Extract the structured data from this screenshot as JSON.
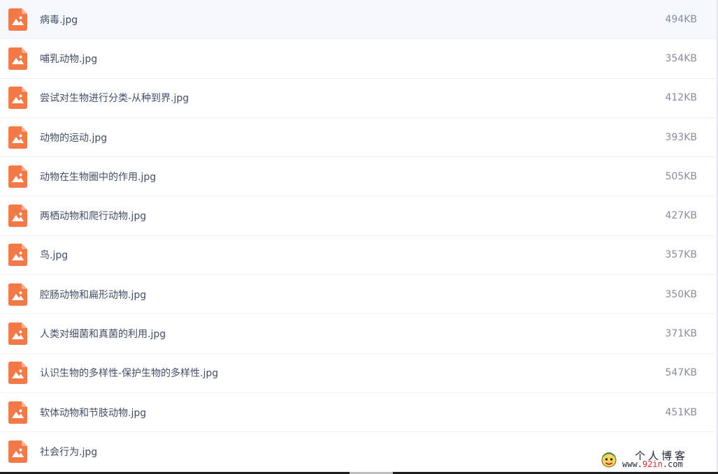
{
  "colors": {
    "icon_orange": "#f37a48",
    "name_text": "#424e67",
    "size_text": "#878c9c",
    "row_divider": "#eef0f4",
    "watermark_accent": "#d12a2a"
  },
  "files": [
    {
      "name": "病毒.jpg",
      "size": "494KB",
      "icon": "image-file-icon"
    },
    {
      "name": "哺乳动物.jpg",
      "size": "354KB",
      "icon": "image-file-icon"
    },
    {
      "name": "尝试对生物进行分类-从种到界.jpg",
      "size": "412KB",
      "icon": "image-file-icon"
    },
    {
      "name": "动物的运动.jpg",
      "size": "393KB",
      "icon": "image-file-icon"
    },
    {
      "name": "动物在生物圈中的作用.jpg",
      "size": "505KB",
      "icon": "image-file-icon"
    },
    {
      "name": "两栖动物和爬行动物.jpg",
      "size": "427KB",
      "icon": "image-file-icon"
    },
    {
      "name": "鸟.jpg",
      "size": "357KB",
      "icon": "image-file-icon"
    },
    {
      "name": "腔肠动物和扁形动物.jpg",
      "size": "350KB",
      "icon": "image-file-icon"
    },
    {
      "name": "人类对细菌和真菌的利用.jpg",
      "size": "371KB",
      "icon": "image-file-icon"
    },
    {
      "name": "认识生物的多样性-保护生物的多样性.jpg",
      "size": "547KB",
      "icon": "image-file-icon"
    },
    {
      "name": "软体动物和节肢动物.jpg",
      "size": "451KB",
      "icon": "image-file-icon"
    },
    {
      "name": "社会行为.jpg",
      "size": "",
      "icon": "image-file-icon"
    }
  ],
  "watermark": {
    "title": "个人博客",
    "url_prefix": "www.",
    "url_accent": "92in",
    "url_suffix": ".com"
  }
}
